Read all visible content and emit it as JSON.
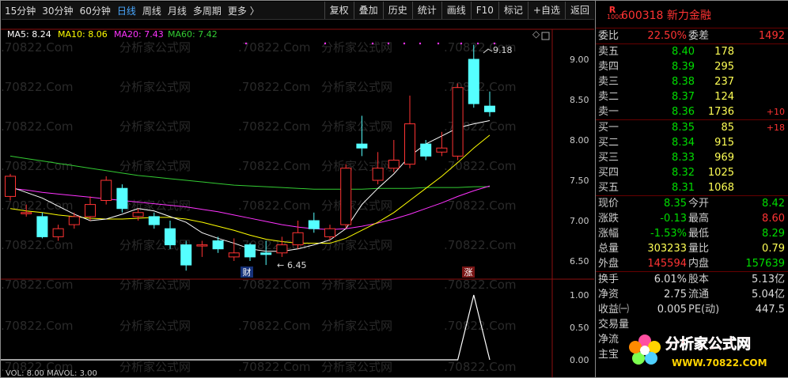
{
  "toolbar": {
    "periods": [
      "15分钟",
      "30分钟",
      "60分钟",
      "日线",
      "周线",
      "月线",
      "多周期"
    ],
    "active_period": "日线",
    "more": "更多 〉",
    "buttons": [
      "复权",
      "叠加",
      "历史",
      "统计",
      "画线",
      "F10",
      "标记",
      "+自选",
      "返回"
    ]
  },
  "ma_legend": [
    {
      "label": "MA5: 8.24",
      "color": "#ffffff"
    },
    {
      "label": "MA10: 8.06",
      "color": "#ffff00"
    },
    {
      "label": "MA20: 7.43",
      "color": "#ff33ff"
    },
    {
      "label": "MA60: 7.42",
      "color": "#33cc33"
    }
  ],
  "price_axis": [
    "9.00",
    "8.50",
    "8.00",
    "7.50",
    "7.00",
    "6.50"
  ],
  "price_range": [
    6.3,
    9.5
  ],
  "high_label": "9.18",
  "low_label": "6.45",
  "arrow_glyph": "←",
  "event_markers": {
    "cai": "财",
    "zhang": "涨"
  },
  "volume_axis": [
    "1.00",
    "0.50",
    "0.00"
  ],
  "volume_legend": "VOL: 8.00  MAVOL: 3.00",
  "watermark": ".70822.Com",
  "watermark_cn": "分析家公式网",
  "candles": [
    {
      "o": 7.3,
      "c": 7.55,
      "h": 7.58,
      "l": 7.25
    },
    {
      "o": 7.1,
      "c": 7.1,
      "h": 7.2,
      "l": 7.05
    },
    {
      "o": 7.05,
      "c": 6.8,
      "h": 7.1,
      "l": 6.78
    },
    {
      "o": 6.8,
      "c": 6.9,
      "h": 6.95,
      "l": 6.75
    },
    {
      "o": 6.95,
      "c": 7.05,
      "h": 7.1,
      "l": 6.9
    },
    {
      "o": 7.05,
      "c": 7.2,
      "h": 7.3,
      "l": 7.0
    },
    {
      "o": 7.25,
      "c": 7.5,
      "h": 7.55,
      "l": 7.2
    },
    {
      "o": 7.4,
      "c": 7.15,
      "h": 7.45,
      "l": 7.1
    },
    {
      "o": 7.05,
      "c": 7.1,
      "h": 7.15,
      "l": 7.0
    },
    {
      "o": 7.05,
      "c": 6.95,
      "h": 7.1,
      "l": 6.9
    },
    {
      "o": 6.9,
      "c": 6.7,
      "h": 7.0,
      "l": 6.65
    },
    {
      "o": 6.7,
      "c": 6.45,
      "h": 6.75,
      "l": 6.38
    },
    {
      "o": 6.7,
      "c": 6.7,
      "h": 6.75,
      "l": 6.55
    },
    {
      "o": 6.75,
      "c": 6.65,
      "h": 6.8,
      "l": 6.6
    },
    {
      "o": 6.55,
      "c": 6.6,
      "h": 6.78,
      "l": 6.5
    },
    {
      "o": 6.7,
      "c": 6.55,
      "h": 6.72,
      "l": 6.5
    },
    {
      "o": 6.6,
      "c": 6.58,
      "h": 6.75,
      "l": 6.45
    },
    {
      "o": 6.6,
      "c": 6.7,
      "h": 6.8,
      "l": 6.55
    },
    {
      "o": 6.7,
      "c": 6.85,
      "h": 7.0,
      "l": 6.65
    },
    {
      "o": 7.0,
      "c": 6.9,
      "h": 7.1,
      "l": 6.85
    },
    {
      "o": 6.8,
      "c": 6.9,
      "h": 6.95,
      "l": 6.75
    },
    {
      "o": 6.95,
      "c": 7.65,
      "h": 7.7,
      "l": 6.9
    },
    {
      "o": 7.95,
      "c": 7.9,
      "h": 8.3,
      "l": 7.8
    },
    {
      "o": 7.5,
      "c": 7.65,
      "h": 7.85,
      "l": 7.45
    },
    {
      "o": 7.65,
      "c": 7.75,
      "h": 8.0,
      "l": 7.6
    },
    {
      "o": 7.7,
      "c": 8.2,
      "h": 8.55,
      "l": 7.65
    },
    {
      "o": 7.95,
      "c": 7.8,
      "h": 8.0,
      "l": 7.75
    },
    {
      "o": 7.85,
      "c": 7.9,
      "h": 8.1,
      "l": 7.8
    },
    {
      "o": 7.8,
      "c": 8.65,
      "h": 8.7,
      "l": 7.75
    },
    {
      "o": 9.0,
      "c": 8.45,
      "h": 9.18,
      "l": 8.4
    },
    {
      "o": 8.42,
      "c": 8.35,
      "h": 8.6,
      "l": 8.29
    }
  ],
  "ma5": [
    7.42,
    7.35,
    7.28,
    7.18,
    7.08,
    7.0,
    7.02,
    7.08,
    7.15,
    7.12,
    7.05,
    6.98,
    6.85,
    6.78,
    6.72,
    6.65,
    6.62,
    6.62,
    6.65,
    6.7,
    6.76,
    6.9,
    7.2,
    7.4,
    7.58,
    7.8,
    7.95,
    8.05,
    8.15,
    8.2,
    8.24
  ],
  "ma10": [
    7.15,
    7.12,
    7.1,
    7.07,
    7.05,
    7.03,
    7.02,
    7.02,
    7.03,
    7.04,
    7.04,
    7.02,
    6.98,
    6.93,
    6.88,
    6.82,
    6.77,
    6.74,
    6.72,
    6.72,
    6.72,
    6.78,
    6.88,
    6.98,
    7.1,
    7.25,
    7.4,
    7.55,
    7.72,
    7.9,
    8.06
  ],
  "ma20": [
    7.4,
    7.38,
    7.35,
    7.33,
    7.31,
    7.29,
    7.27,
    7.25,
    7.23,
    7.21,
    7.19,
    7.17,
    7.14,
    7.11,
    7.07,
    7.03,
    6.99,
    6.95,
    6.92,
    6.9,
    6.89,
    6.9,
    6.93,
    6.97,
    7.02,
    7.08,
    7.15,
    7.22,
    7.3,
    7.37,
    7.43
  ],
  "ma60": [
    7.8,
    7.77,
    7.74,
    7.71,
    7.68,
    7.65,
    7.62,
    7.59,
    7.56,
    7.54,
    7.52,
    7.5,
    7.48,
    7.46,
    7.44,
    7.43,
    7.42,
    7.41,
    7.4,
    7.39,
    7.39,
    7.39,
    7.39,
    7.4,
    7.4,
    7.4,
    7.41,
    7.41,
    7.41,
    7.42,
    7.42
  ],
  "volume_spike_value": 1.0,
  "panel": {
    "code": "600318 新力金融",
    "badge_r": "R",
    "badge_num": "1000",
    "webi": {
      "label": "委比",
      "value": "22.50%",
      "label2": "委差",
      "value2": "1492"
    },
    "asks": [
      {
        "label": "卖五",
        "price": "8.40",
        "vol": "178",
        "chg": ""
      },
      {
        "label": "卖四",
        "price": "8.39",
        "vol": "295",
        "chg": ""
      },
      {
        "label": "卖三",
        "price": "8.38",
        "vol": "237",
        "chg": ""
      },
      {
        "label": "卖二",
        "price": "8.37",
        "vol": "124",
        "chg": ""
      },
      {
        "label": "卖一",
        "price": "8.36",
        "vol": "1736",
        "chg": "+10"
      }
    ],
    "bids": [
      {
        "label": "买一",
        "price": "8.35",
        "vol": "85",
        "chg": "+18"
      },
      {
        "label": "买二",
        "price": "8.34",
        "vol": "915",
        "chg": ""
      },
      {
        "label": "买三",
        "price": "8.33",
        "vol": "969",
        "chg": ""
      },
      {
        "label": "买四",
        "price": "8.32",
        "vol": "1025",
        "chg": ""
      },
      {
        "label": "买五",
        "price": "8.31",
        "vol": "1068",
        "chg": ""
      }
    ],
    "quote": [
      {
        "l1": "现价",
        "v1": "8.35",
        "c1": "green",
        "l2": "今开",
        "v2": "8.42",
        "c2": "green"
      },
      {
        "l1": "涨跌",
        "v1": "-0.13",
        "c1": "green",
        "l2": "最高",
        "v2": "8.60",
        "c2": "red"
      },
      {
        "l1": "涨幅",
        "v1": "-1.53%",
        "c1": "green",
        "l2": "最低",
        "v2": "8.29",
        "c2": "green"
      },
      {
        "l1": "总量",
        "v1": "303233",
        "c1": "yellow",
        "l2": "量比",
        "v2": "0.79",
        "c2": "yellow"
      },
      {
        "l1": "外盘",
        "v1": "145594",
        "c1": "red",
        "l2": "内盘",
        "v2": "157639",
        "c2": "green"
      }
    ],
    "stats": [
      {
        "l1": "换手",
        "v1": "6.01%",
        "l2": "股本",
        "v2": "5.13亿"
      },
      {
        "l1": "净资",
        "v1": "2.75",
        "l2": "流通",
        "v2": "5.04亿"
      },
      {
        "l1": "收益㈠",
        "v1": "0.005",
        "l2": "PE(动)",
        "v2": "447.5"
      }
    ],
    "extra": [
      "交易量",
      "净流",
      "主宝"
    ],
    "logo_text": "分析家公式网",
    "logo_url": "WWW.70822.COM"
  },
  "colors": {
    "up": "#ff3333",
    "down": "#55ffff",
    "bg": "#000000"
  }
}
